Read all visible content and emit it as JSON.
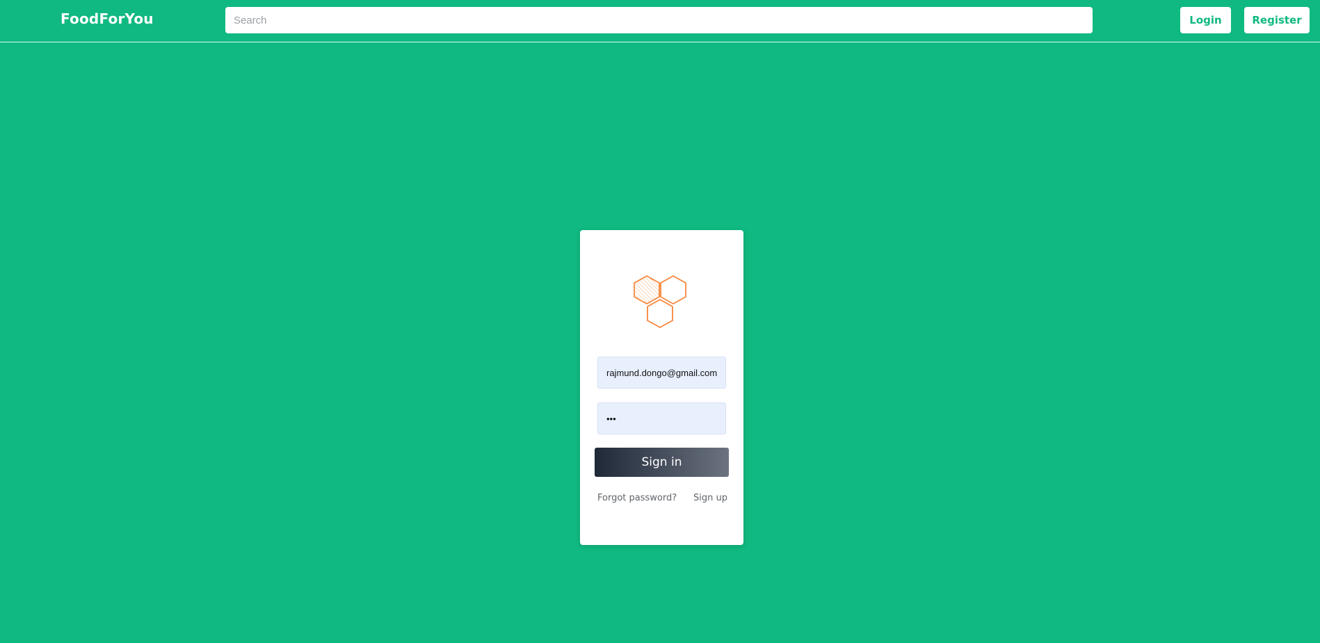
{
  "header": {
    "brand": "FoodForYou",
    "search_placeholder": "Search",
    "login_label": "Login",
    "register_label": "Register"
  },
  "login_card": {
    "logo_icon": "hexagon-cluster-icon",
    "email_value": "rajmund.dongo@gmail.com",
    "password_value": "•••",
    "signin_label": "Sign in",
    "forgot_label": "Forgot password?",
    "signup_label": "Sign up"
  },
  "colors": {
    "background": "#10b981",
    "accent": "#10b981",
    "logo": "#f5873a",
    "input_bg": "#e8f0fe"
  }
}
